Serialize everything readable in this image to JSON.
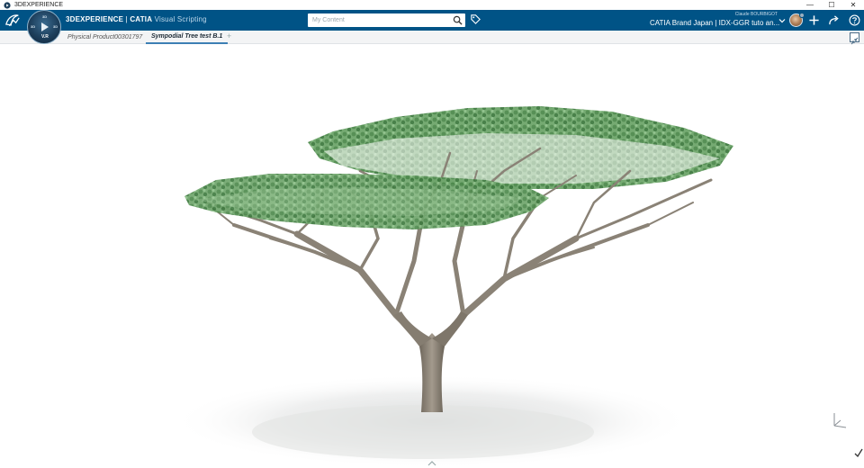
{
  "window": {
    "title": "3DEXPERIENCE",
    "controls": {
      "minimize": "—",
      "maximize": "☐",
      "close": "✕"
    }
  },
  "topbar": {
    "brand_bold": "3DEXPERIENCE",
    "brand_separator": " | ",
    "brand_app": "CATIA",
    "brand_role": " Visual Scripting",
    "compass_version": "V.R",
    "compass_quadrants": {
      "top": "3D",
      "left": "3D",
      "right": "3D",
      "bottom": "V.R"
    },
    "search": {
      "placeholder": "My Content",
      "value": ""
    },
    "user_name": "Claude BOURBIGOT",
    "context": "CATIA Brand Japan | IDX-GGR tuto an...",
    "icons": [
      "ds-logo-icon",
      "search-icon",
      "tag-icon",
      "chevron-down-icon",
      "plus-icon",
      "share-icon",
      "help-icon"
    ]
  },
  "tabs": [
    {
      "label": "Physical Product00301797",
      "active": false
    },
    {
      "label": "Sympodial Tree test B.1",
      "active": true
    }
  ],
  "tab_add_label": "+",
  "viewport": {
    "content": "3D tree model",
    "colors": {
      "foliage": "#5f9a5c",
      "trunk": "#8a8276",
      "background": "#ffffff",
      "accent": "#005386"
    }
  }
}
